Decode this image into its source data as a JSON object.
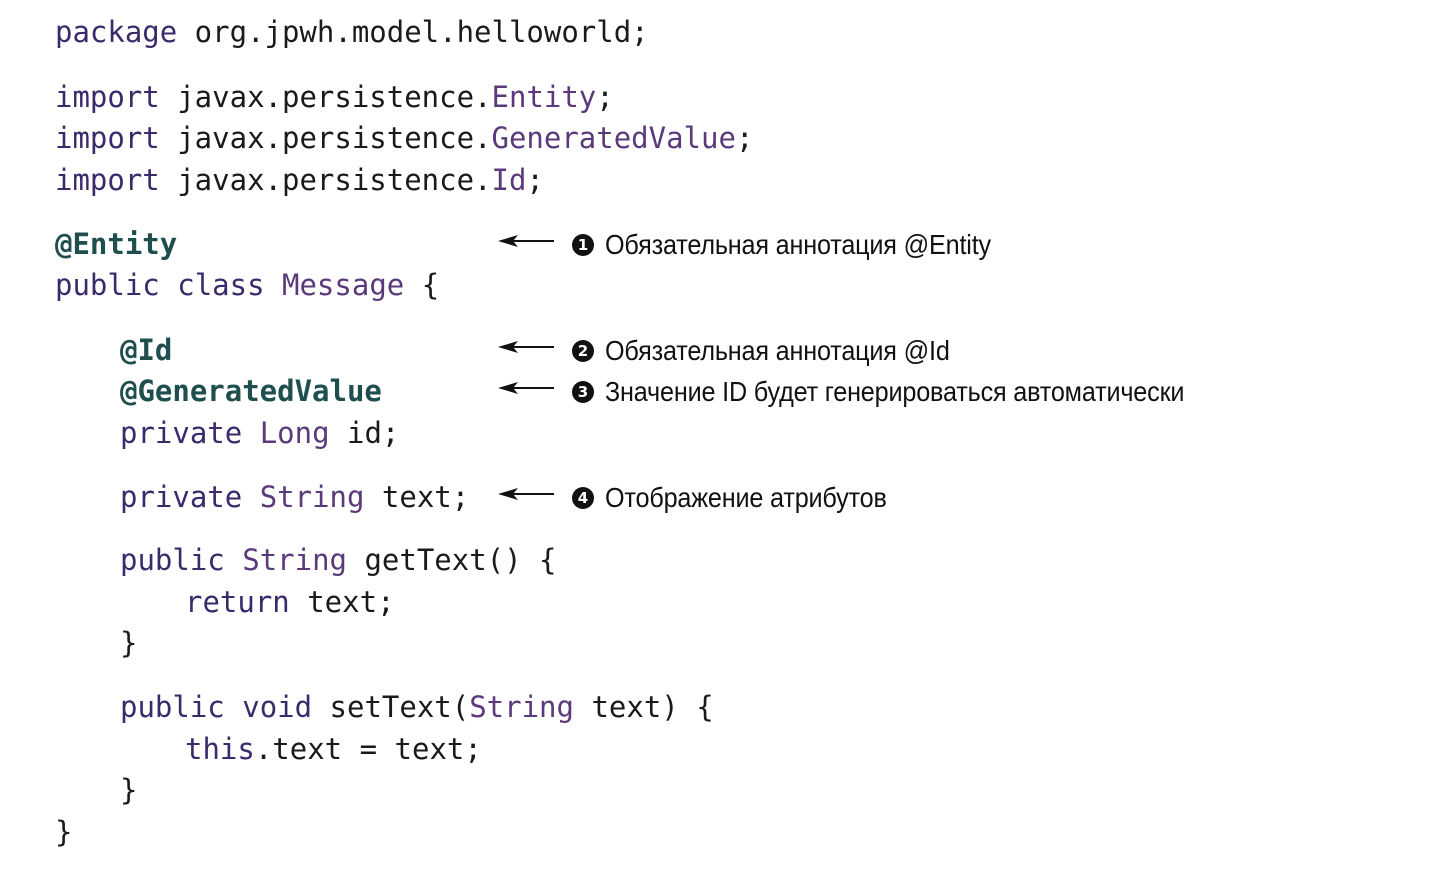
{
  "code": {
    "package_kw": "package",
    "package_name": " org.jpwh.model.helloworld;",
    "import_kw": "import",
    "import_prefix": " javax.persistence.",
    "import_1_type": "Entity",
    "import_2_type": "GeneratedValue",
    "import_3_type": "Id",
    "semicolon": ";",
    "entity_annotation": "@Entity",
    "public_kw": "public",
    "class_kw": "class",
    "class_name": "Message",
    "open_brace": "{",
    "close_brace": "}",
    "id_annotation": "@Id",
    "generated_annotation": "@GeneratedValue",
    "private_kw": "private",
    "long_type": "Long",
    "id_field": " id;",
    "string_type": "String",
    "text_field": " text;",
    "get_text_sig": " getText() {",
    "return_kw": "return",
    "return_expr": " text;",
    "void_kw": "void",
    "set_text_open": " setText(",
    "set_text_param": " text) {",
    "this_kw": "this",
    "assign_expr": ".text = text;"
  },
  "callouts": [
    {
      "number": "1",
      "text": "Обязательная аннотация @Entity"
    },
    {
      "number": "2",
      "text": "Обязательная аннотация @Id"
    },
    {
      "number": "3",
      "text": "Значение ID будет генерироваться автоматически"
    },
    {
      "number": "4",
      "text": "Отображение атрибутов"
    }
  ]
}
